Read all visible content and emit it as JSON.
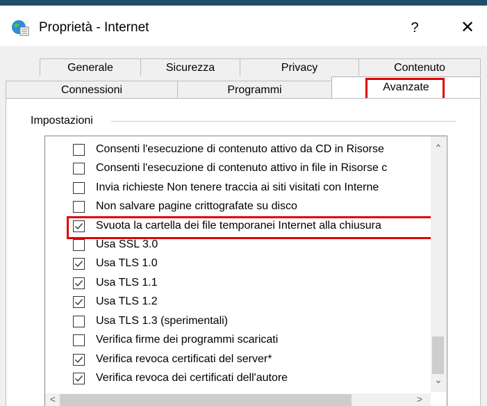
{
  "window": {
    "title": "Proprietà - Internet",
    "help_label": "?",
    "close_label": "✕",
    "icon": "internet-options-icon"
  },
  "tabs_row1": [
    {
      "label": "Generale"
    },
    {
      "label": "Sicurezza"
    },
    {
      "label": "Privacy"
    },
    {
      "label": "Contenuto"
    }
  ],
  "tabs_row2": [
    {
      "label": "Connessioni"
    },
    {
      "label": "Programmi"
    },
    {
      "label": "Avanzate",
      "active": true
    }
  ],
  "settings": {
    "group_label": "Impostazioni",
    "items": [
      {
        "label": "Consenti l'esecuzione di contenuto attivo da CD in Risorse",
        "checked": false
      },
      {
        "label": "Consenti l'esecuzione di contenuto attivo in file in Risorse c",
        "checked": false
      },
      {
        "label": "Invia richieste Non tenere traccia ai siti visitati con Interne",
        "checked": false
      },
      {
        "label": "Non salvare pagine crittografate su disco",
        "checked": false
      },
      {
        "label": "Svuota la cartella dei file temporanei Internet alla chiusura",
        "checked": true
      },
      {
        "label": "Usa SSL 3.0",
        "checked": false
      },
      {
        "label": "Usa TLS 1.0",
        "checked": true
      },
      {
        "label": "Usa TLS 1.1",
        "checked": true
      },
      {
        "label": "Usa TLS 1.2",
        "checked": true
      },
      {
        "label": "Usa TLS 1.3 (sperimentali)",
        "checked": false
      },
      {
        "label": "Verifica firme dei programmi scaricati",
        "checked": false
      },
      {
        "label": "Verifica revoca certificati del server*",
        "checked": true
      },
      {
        "label": "Verifica revoca dei certificati dell'autore",
        "checked": true
      }
    ]
  },
  "scrollbar": {
    "up": "⌃",
    "down": "⌄",
    "left": "<",
    "right": ">"
  },
  "colors": {
    "highlight": "#e00000",
    "titlebar_accent": "#1f4e6b"
  }
}
